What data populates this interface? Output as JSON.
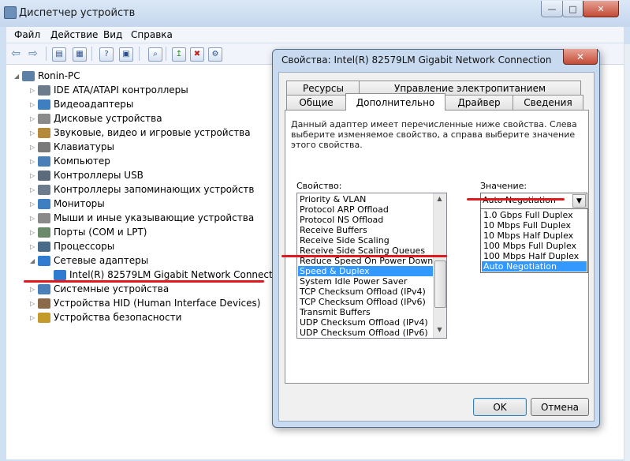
{
  "main_window": {
    "title": "Диспетчер устройств",
    "menu": [
      "Файл",
      "Действие",
      "Вид",
      "Справка"
    ],
    "caption_buttons": {
      "minimize": "—",
      "maximize": "□",
      "close": "✕"
    },
    "tree": {
      "root": "Ronin-PC",
      "items": [
        {
          "label": "IDE ATA/ATAPI контроллеры",
          "icon": "disk-controller-icon",
          "color": "#6d7c8c"
        },
        {
          "label": "Видеоадаптеры",
          "icon": "display-adapter-icon",
          "color": "#3d7fc1"
        },
        {
          "label": "Дисковые устройства",
          "icon": "disk-drive-icon",
          "color": "#8a8a8a"
        },
        {
          "label": "Звуковые, видео и игровые устройства",
          "icon": "sound-icon",
          "color": "#b48a3a"
        },
        {
          "label": "Клавиатуры",
          "icon": "keyboard-icon",
          "color": "#7a7a7a"
        },
        {
          "label": "Компьютер",
          "icon": "computer-icon",
          "color": "#4a7fb8"
        },
        {
          "label": "Контроллеры USB",
          "icon": "usb-icon",
          "color": "#5b6b7b"
        },
        {
          "label": "Контроллеры запоминающих устройств",
          "icon": "storage-controller-icon",
          "color": "#6d7c8c"
        },
        {
          "label": "Мониторы",
          "icon": "monitor-icon",
          "color": "#3d7fc1"
        },
        {
          "label": "Мыши и иные указывающие устройства",
          "icon": "mouse-icon",
          "color": "#8a8a8a"
        },
        {
          "label": "Порты (COM и LPT)",
          "icon": "port-icon",
          "color": "#6a8a6a"
        },
        {
          "label": "Процессоры",
          "icon": "processor-icon",
          "color": "#4a6a8a"
        },
        {
          "label": "Сетевые адаптеры",
          "icon": "network-adapter-icon",
          "color": "#2f7bd0"
        },
        {
          "label": "Intel(R) 82579LM Gigabit Network Connection",
          "icon": "network-card-icon",
          "color": "#2f7bd0"
        },
        {
          "label": "Системные устройства",
          "icon": "system-device-icon",
          "color": "#4a7fb8"
        },
        {
          "label": "Устройства HID (Human Interface Devices)",
          "icon": "hid-icon",
          "color": "#8a6a4a"
        },
        {
          "label": "Устройства безопасности",
          "icon": "security-device-icon",
          "color": "#c49a2a"
        }
      ]
    }
  },
  "dialog": {
    "title": "Свойства: Intel(R) 82579LM Gigabit Network Connection",
    "close": "✕",
    "tabs_row1": [
      "Ресурсы",
      "Управление электропитанием"
    ],
    "tabs_row2": [
      "Общие",
      "Дополнительно",
      "Драйвер",
      "Сведения"
    ],
    "active_tab": "Дополнительно",
    "description": "Данный адаптер имеет перечисленные ниже свойства. Слева выберите изменяемое свойство, а справа выберите значение этого свойства.",
    "property_label": "Свойство:",
    "value_label": "Значение:",
    "properties": [
      "Priority & VLAN",
      "Protocol ARP Offload",
      "Protocol NS Offload",
      "Receive Buffers",
      "Receive Side Scaling",
      "Receive Side Scaling Queues",
      "Reduce Speed On Power Down",
      "Speed & Duplex",
      "System Idle Power Saver",
      "TCP Checksum Offload (IPv4)",
      "TCP Checksum Offload (IPv6)",
      "Transmit Buffers",
      "UDP Checksum Offload (IPv4)",
      "UDP Checksum Offload (IPv6)"
    ],
    "selected_property": "Speed & Duplex",
    "value_current": "Auto Negotiation",
    "value_options": [
      "1.0 Gbps Full Duplex",
      "10 Mbps Full Duplex",
      "10 Mbps Half Duplex",
      "100 Mbps Full Duplex",
      "100 Mbps Half Duplex",
      "Auto Negotiation"
    ],
    "ok": "OK",
    "cancel": "Отмена"
  },
  "colors": {
    "selection": "#3399ff",
    "annotation": "#e0191d"
  }
}
